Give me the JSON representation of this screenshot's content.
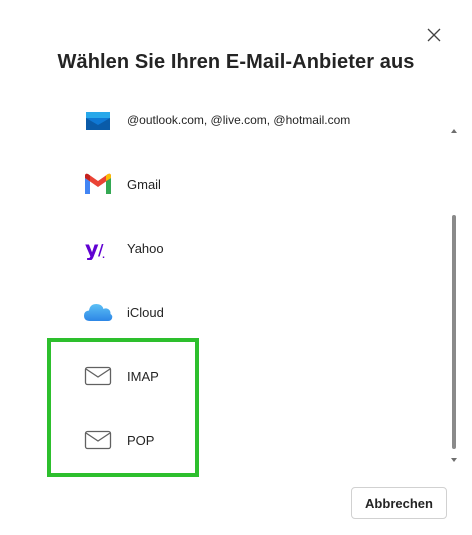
{
  "dialog": {
    "title": "Wählen Sie Ihren E-Mail-Anbieter aus",
    "close_icon": "close-icon",
    "cancel_label": "Abbrechen"
  },
  "providers": [
    {
      "label": "@outlook.com, @live.com, @hotmail.com",
      "icon": "outlook-icon",
      "color": "#0078d4"
    },
    {
      "label": "Gmail",
      "icon": "gmail-icon",
      "colors": [
        "#ea4335",
        "#4285f4",
        "#34a853",
        "#fbbc04"
      ]
    },
    {
      "label": "Yahoo",
      "icon": "yahoo-icon",
      "color": "#6001d2"
    },
    {
      "label": "iCloud",
      "icon": "icloud-icon",
      "color": "#3e9bef"
    },
    {
      "label": "IMAP",
      "icon": "mail-icon"
    },
    {
      "label": "POP",
      "icon": "mail-icon"
    }
  ],
  "highlight_color": "#2dbf2d"
}
